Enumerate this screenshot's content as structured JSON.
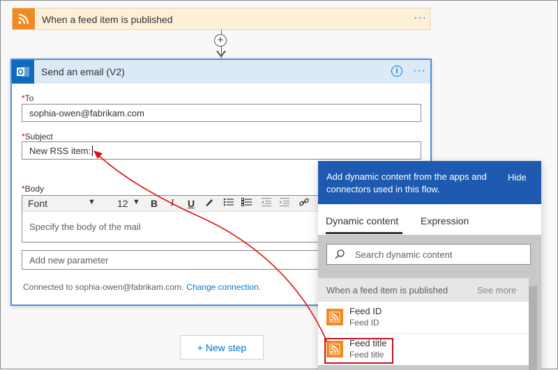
{
  "trigger": {
    "title": "When a feed item is published",
    "more": "···"
  },
  "action": {
    "title": "Send an email (V2)",
    "info": "i",
    "more": "···",
    "fields": {
      "to": {
        "label": "To",
        "required": "*",
        "value": "sophia-owen@fabrikam.com"
      },
      "subject": {
        "label": "Subject",
        "required": "*",
        "value": "New RSS item:"
      },
      "body": {
        "label": "Body",
        "required": "*",
        "placeholder": "Specify the body of the mail"
      }
    },
    "editor": {
      "font": "Font",
      "size": "12"
    },
    "add_parameter": "Add new parameter",
    "connected_text": "Connected to sophia-owen@fabrikam.com.",
    "change_connection": "Change connection."
  },
  "new_step": "+ New step",
  "panel": {
    "header": "Add dynamic content from the apps and connectors used in this flow.",
    "hide": "Hide",
    "tabs": [
      "Dynamic content",
      "Expression"
    ],
    "search_placeholder": "Search dynamic content",
    "group": {
      "title": "When a feed item is published",
      "see_more": "See more"
    },
    "items": [
      {
        "title": "Feed ID",
        "subtitle": "Feed ID"
      },
      {
        "title": "Feed title",
        "subtitle": "Feed title"
      }
    ]
  },
  "colors": {
    "rss": "#f08a24",
    "outlook": "#0f6cbd",
    "accent": "#0078d4",
    "panel_header": "#1e5bb0",
    "highlight": "#c50f1f"
  }
}
